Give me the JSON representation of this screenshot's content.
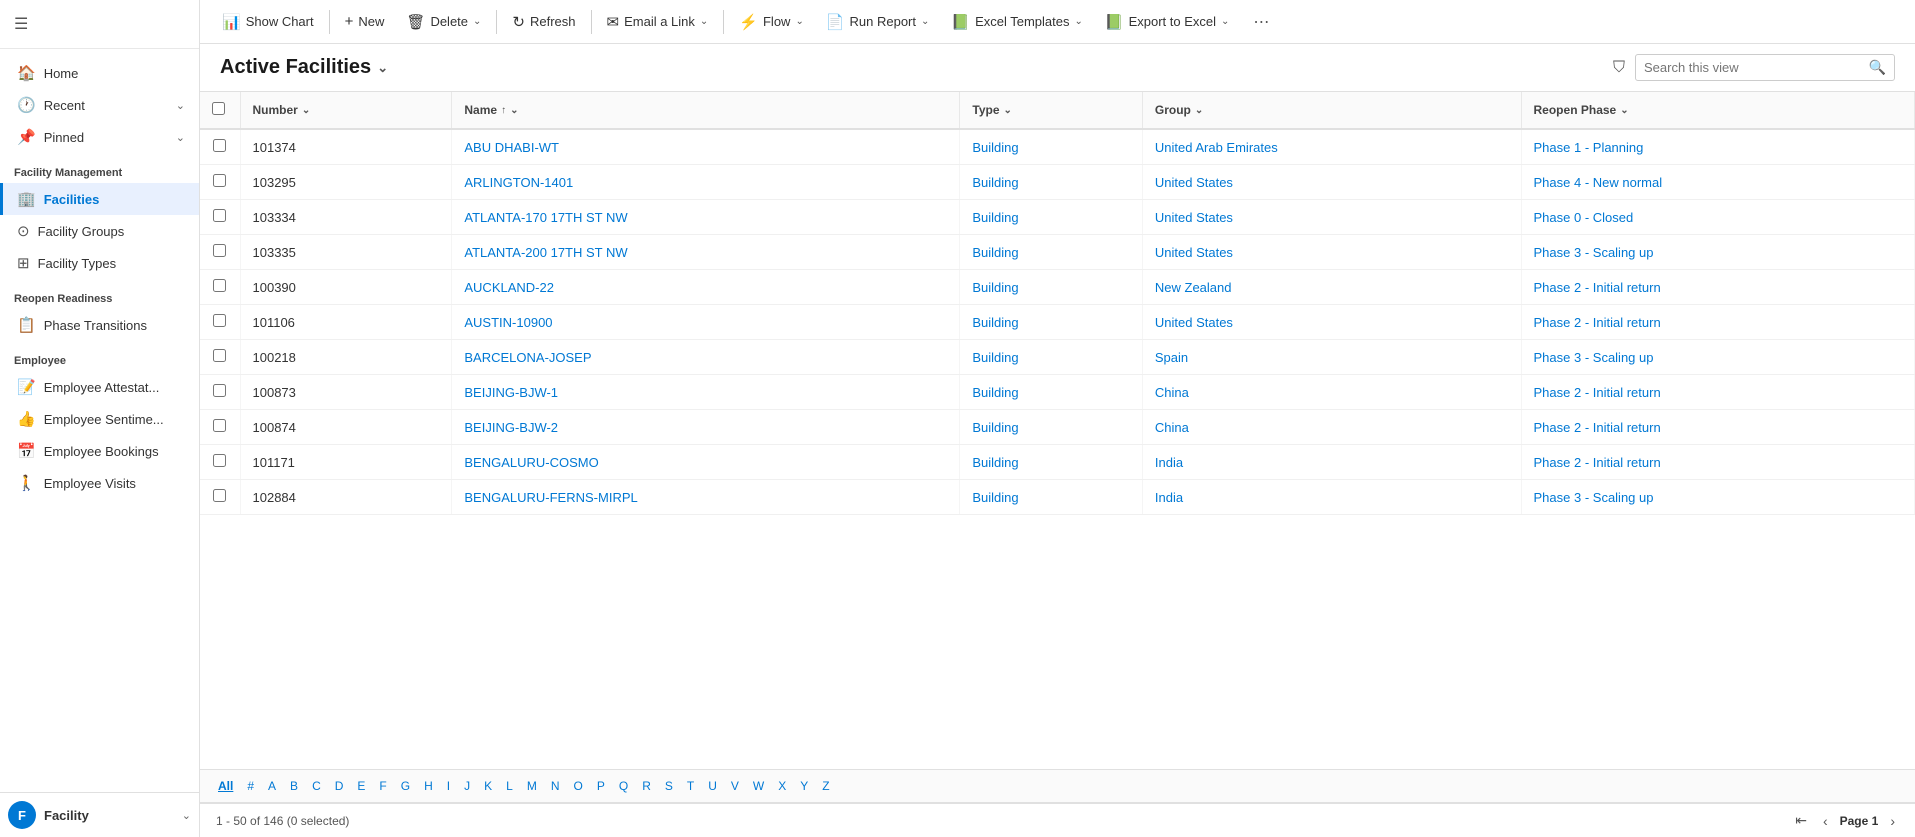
{
  "sidebar": {
    "nav_items": [
      {
        "id": "home",
        "label": "Home",
        "icon": "🏠",
        "active": false,
        "has_chevron": false
      },
      {
        "id": "recent",
        "label": "Recent",
        "icon": "🕐",
        "active": false,
        "has_chevron": true
      },
      {
        "id": "pinned",
        "label": "Pinned",
        "icon": "📌",
        "active": false,
        "has_chevron": true
      }
    ],
    "sections": [
      {
        "label": "Facility Management",
        "items": [
          {
            "id": "facilities",
            "label": "Facilities",
            "icon": "🏢",
            "active": true
          },
          {
            "id": "facility-groups",
            "label": "Facility Groups",
            "icon": "⊙",
            "active": false
          },
          {
            "id": "facility-types",
            "label": "Facility Types",
            "icon": "⊞",
            "active": false
          }
        ]
      },
      {
        "label": "Reopen Readiness",
        "items": [
          {
            "id": "phase-transitions",
            "label": "Phase Transitions",
            "icon": "📋",
            "active": false
          }
        ]
      },
      {
        "label": "Employee",
        "items": [
          {
            "id": "employee-attest",
            "label": "Employee Attestat...",
            "icon": "📝",
            "active": false
          },
          {
            "id": "employee-sentiment",
            "label": "Employee Sentime...",
            "icon": "👍",
            "active": false
          },
          {
            "id": "employee-bookings",
            "label": "Employee Bookings",
            "icon": "📅",
            "active": false
          },
          {
            "id": "employee-visits",
            "label": "Employee Visits",
            "icon": "🚶",
            "active": false
          }
        ]
      }
    ],
    "bottom": {
      "avatar_letter": "F",
      "label": "Facility"
    }
  },
  "toolbar": {
    "buttons": [
      {
        "id": "show-chart",
        "label": "Show Chart",
        "icon": "📊",
        "has_dropdown": false
      },
      {
        "id": "new",
        "label": "New",
        "icon": "+",
        "has_dropdown": false
      },
      {
        "id": "delete",
        "label": "Delete",
        "icon": "🗑",
        "has_dropdown": true
      },
      {
        "id": "refresh",
        "label": "Refresh",
        "icon": "↻",
        "has_dropdown": false
      },
      {
        "id": "email-link",
        "label": "Email a Link",
        "icon": "✉",
        "has_dropdown": true
      },
      {
        "id": "flow",
        "label": "Flow",
        "icon": "⚡",
        "has_dropdown": true
      },
      {
        "id": "run-report",
        "label": "Run Report",
        "icon": "📄",
        "has_dropdown": true
      },
      {
        "id": "excel-templates",
        "label": "Excel Templates",
        "icon": "📗",
        "has_dropdown": true
      },
      {
        "id": "export-excel",
        "label": "Export to Excel",
        "icon": "📗",
        "has_dropdown": true
      }
    ]
  },
  "view": {
    "title": "Active Facilities",
    "search_placeholder": "Search this view"
  },
  "table": {
    "columns": [
      {
        "id": "number",
        "label": "Number",
        "sortable": true,
        "sort_dir": ""
      },
      {
        "id": "name",
        "label": "Name",
        "sortable": true,
        "sort_dir": "asc"
      },
      {
        "id": "type",
        "label": "Type",
        "sortable": true,
        "sort_dir": ""
      },
      {
        "id": "group",
        "label": "Group",
        "sortable": true,
        "sort_dir": ""
      },
      {
        "id": "reopen_phase",
        "label": "Reopen Phase",
        "sortable": true,
        "sort_dir": ""
      }
    ],
    "rows": [
      {
        "number": "101374",
        "name": "ABU DHABI-WT",
        "type": "Building",
        "group": "United Arab Emirates",
        "reopen_phase": "Phase 1 - Planning"
      },
      {
        "number": "103295",
        "name": "ARLINGTON-1401",
        "type": "Building",
        "group": "United States",
        "reopen_phase": "Phase 4 - New normal"
      },
      {
        "number": "103334",
        "name": "ATLANTA-170 17TH ST NW",
        "type": "Building",
        "group": "United States",
        "reopen_phase": "Phase 0 - Closed"
      },
      {
        "number": "103335",
        "name": "ATLANTA-200 17TH ST NW",
        "type": "Building",
        "group": "United States",
        "reopen_phase": "Phase 3 - Scaling up"
      },
      {
        "number": "100390",
        "name": "AUCKLAND-22",
        "type": "Building",
        "group": "New Zealand",
        "reopen_phase": "Phase 2 - Initial return"
      },
      {
        "number": "101106",
        "name": "AUSTIN-10900",
        "type": "Building",
        "group": "United States",
        "reopen_phase": "Phase 2 - Initial return"
      },
      {
        "number": "100218",
        "name": "BARCELONA-JOSEP",
        "type": "Building",
        "group": "Spain",
        "reopen_phase": "Phase 3 - Scaling up"
      },
      {
        "number": "100873",
        "name": "BEIJING-BJW-1",
        "type": "Building",
        "group": "China",
        "reopen_phase": "Phase 2 - Initial return"
      },
      {
        "number": "100874",
        "name": "BEIJING-BJW-2",
        "type": "Building",
        "group": "China",
        "reopen_phase": "Phase 2 - Initial return"
      },
      {
        "number": "101171",
        "name": "BENGALURU-COSMO",
        "type": "Building",
        "group": "India",
        "reopen_phase": "Phase 2 - Initial return"
      },
      {
        "number": "102884",
        "name": "BENGALURU-FERNS-MIRPL",
        "type": "Building",
        "group": "India",
        "reopen_phase": "Phase 3 - Scaling up"
      }
    ]
  },
  "alphabet": [
    "All",
    "#",
    "A",
    "B",
    "C",
    "D",
    "E",
    "F",
    "G",
    "H",
    "I",
    "J",
    "K",
    "L",
    "M",
    "N",
    "O",
    "P",
    "Q",
    "R",
    "S",
    "T",
    "U",
    "V",
    "W",
    "X",
    "Y",
    "Z"
  ],
  "footer": {
    "summary": "1 - 50 of 146 (0 selected)",
    "page_label": "Page 1"
  }
}
